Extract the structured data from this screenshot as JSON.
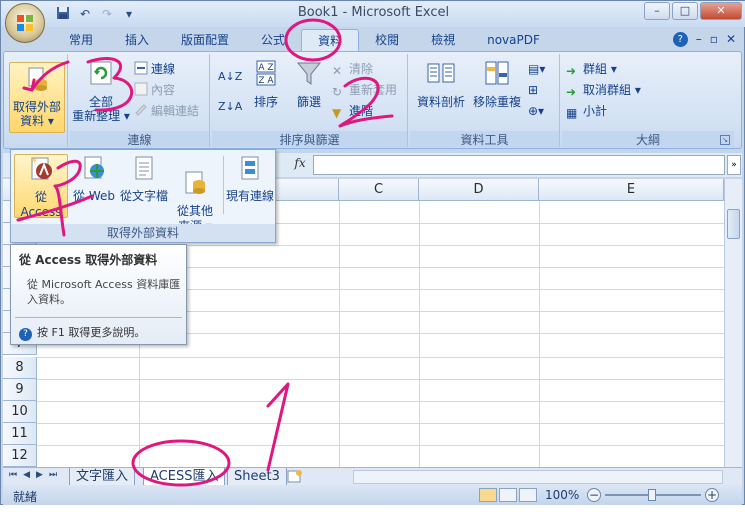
{
  "window": {
    "title": "Book1 - Microsoft Excel",
    "controls": {
      "minimize": "–",
      "maximize": "□",
      "close": "✕"
    }
  },
  "quick_access": {
    "items": [
      "save-icon",
      "undo-icon",
      "redo-icon",
      "customize-icon"
    ]
  },
  "tabs": [
    "常用",
    "插入",
    "版面配置",
    "公式",
    "資料",
    "校閱",
    "檢視",
    "novaPDF"
  ],
  "active_tab": "資料",
  "ribbon_right": {
    "help": "?",
    "minimize": "–",
    "restore": "▫",
    "close": "✕"
  },
  "ribbon": {
    "external_data": {
      "label_line1": "取得外部",
      "label_line2": "資料 ▾"
    },
    "connections": {
      "refresh_line1": "全部",
      "refresh_line2": "重新整理 ▾",
      "connections": "連線",
      "properties": "內容",
      "edit_links": "編輯連結",
      "group_label": "連線"
    },
    "sort_filter": {
      "sort": "排序",
      "filter": "篩選",
      "clear": "清除",
      "reapply": "重新套用",
      "advanced": "進階",
      "group_label": "排序與篩選"
    },
    "data_tools": {
      "text_to_columns": "資料剖析",
      "remove_duplicates": "移除重複",
      "group_label": "資料工具"
    },
    "outline": {
      "group": "群組 ▾",
      "ungroup": "取消群組 ▾",
      "subtotal": "小計",
      "group_label": "大綱"
    }
  },
  "formula_bar": {
    "fx": "fx",
    "expand": "»"
  },
  "columns": [
    "C",
    "D",
    "E"
  ],
  "rows": [
    "7",
    "8",
    "9",
    "10",
    "11",
    "12"
  ],
  "sheets": [
    "文字匯入",
    "ACESS匯入",
    "Sheet3"
  ],
  "active_sheet": "ACESS匯入",
  "status": {
    "ready": "就緒",
    "zoom": "100%"
  },
  "gallery": {
    "items": [
      "從 Access",
      "從 Web",
      "從文字檔",
      "從其他\n來源 ▾",
      "現有連線"
    ],
    "group_label": "取得外部資料"
  },
  "tooltip": {
    "title": "從 Access 取得外部資料",
    "body": "從 Microsoft Access 資料庫匯入資料。",
    "help": "按 F1 取得更多說明。"
  },
  "colors": {
    "ribbon_text": "#15428b",
    "annotation": "#e0177f",
    "hot_item": "#ffd872"
  }
}
